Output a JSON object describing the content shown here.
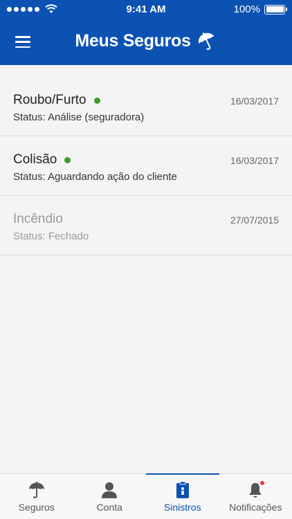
{
  "status_bar": {
    "time": "9:41 AM",
    "battery": "100%"
  },
  "header": {
    "title": "Meus Seguros",
    "menu_icon": "hamburger-icon",
    "logo_icon": "umbrella-icon"
  },
  "claims": [
    {
      "name": "Roubo/Furto",
      "status": "Status: Análise (seguradora)",
      "date": "16/03/2017",
      "active": true
    },
    {
      "name": "Colisão",
      "status": "Status: Aguardando ação do cliente",
      "date": "16/03/2017",
      "active": true
    },
    {
      "name": "Incêndio",
      "status": "Status: Fechado",
      "date": "27/07/2015",
      "active": false
    }
  ],
  "tabs": [
    {
      "label": "Seguros",
      "icon": "umbrella-icon"
    },
    {
      "label": "Conta",
      "icon": "person-icon"
    },
    {
      "label": "Sinistros",
      "icon": "clipboard-badge-icon",
      "active": true
    },
    {
      "label": "Notificações",
      "icon": "bell-icon",
      "has_badge": true
    }
  ],
  "colors": {
    "primary": "#0b52b3",
    "active_dot": "#3f9d2a",
    "notification_badge": "#e53935"
  }
}
